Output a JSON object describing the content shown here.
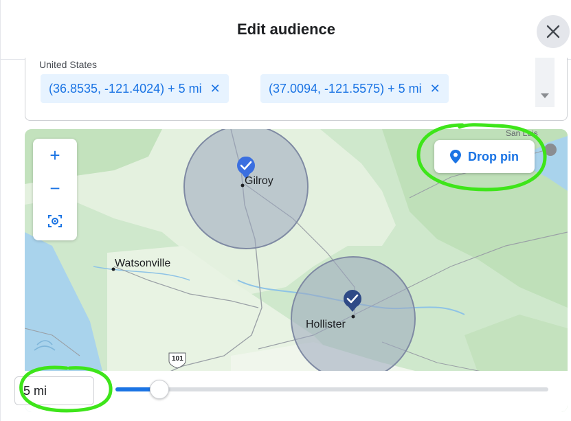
{
  "dialog": {
    "title": "Edit audience"
  },
  "locations": {
    "country": "United States",
    "chips": [
      {
        "label": "(36.8535, -121.4024)  + 5 mi",
        "remove": "✕"
      },
      {
        "label": "(37.0094, -121.5575)  + 5 mi",
        "remove": "✕"
      }
    ]
  },
  "map": {
    "zoom_in": "+",
    "zoom_out": "−",
    "drop_pin_label": "Drop pin",
    "cities": {
      "gilroy": "Gilroy",
      "watsonville": "Watsonville",
      "hollister": "Hollister",
      "highway": "101",
      "san_luis": "San Luis"
    }
  },
  "radius": {
    "value_label": "5 mi",
    "fraction": 0.1
  },
  "colors": {
    "accent": "#1b74e4",
    "chip_bg": "#e7f3ff",
    "annotation": "#3ee51a",
    "circle_fill": "#9aa6bd"
  }
}
